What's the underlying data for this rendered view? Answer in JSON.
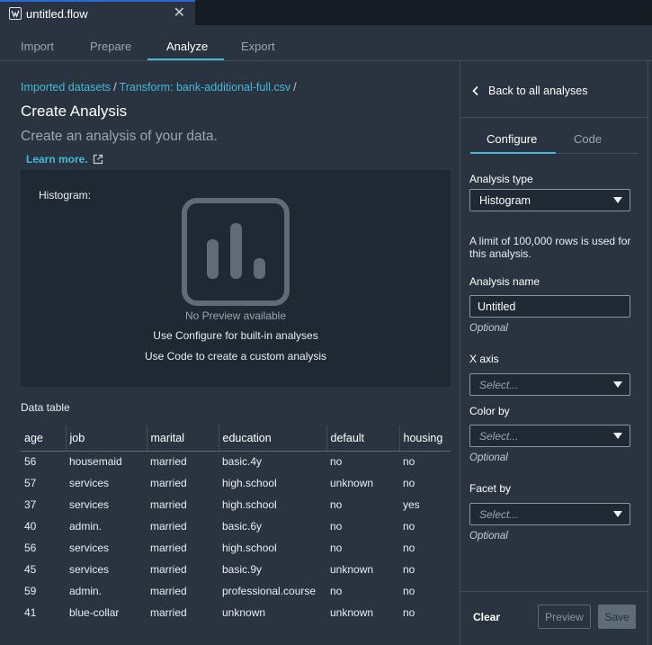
{
  "window": {
    "file_tab": "untitled.flow",
    "close_symbol": "✕"
  },
  "nav": {
    "tabs": [
      "Import",
      "Prepare",
      "Analyze",
      "Export"
    ],
    "active": "Analyze"
  },
  "breadcrumb": {
    "items": [
      "Imported datasets",
      "Transform: bank-additional-full.csv"
    ],
    "separator": "/"
  },
  "header": {
    "title": "Create Analysis",
    "subtitle": "Create an analysis of your data.",
    "learn_more": "Learn more."
  },
  "preview": {
    "label": "Histogram:",
    "no_preview": "No Preview available",
    "hint_configure": "Use Configure for built-in analyses",
    "hint_code": "Use Code to create a custom analysis"
  },
  "data_table": {
    "label": "Data table",
    "columns": [
      "age",
      "job",
      "marital",
      "education",
      "default",
      "housing"
    ],
    "rows": [
      [
        "56",
        "housemaid",
        "married",
        "basic.4y",
        "no",
        "no"
      ],
      [
        "57",
        "services",
        "married",
        "high.school",
        "unknown",
        "no"
      ],
      [
        "37",
        "services",
        "married",
        "high.school",
        "no",
        "yes"
      ],
      [
        "40",
        "admin.",
        "married",
        "basic.6y",
        "no",
        "no"
      ],
      [
        "56",
        "services",
        "married",
        "high.school",
        "no",
        "no"
      ],
      [
        "45",
        "services",
        "married",
        "basic.9y",
        "unknown",
        "no"
      ],
      [
        "59",
        "admin.",
        "married",
        "professional.course",
        "no",
        "no"
      ],
      [
        "41",
        "blue-collar",
        "married",
        "unknown",
        "unknown",
        "no"
      ]
    ]
  },
  "sidebar": {
    "back": "Back to all analyses",
    "tabs": {
      "configure": "Configure",
      "code": "Code"
    },
    "analysis_type": {
      "label": "Analysis type",
      "value": "Histogram"
    },
    "row_limit_note": "A limit of 100,000 rows is used for this analysis.",
    "analysis_name": {
      "label": "Analysis name",
      "value": "Untitled",
      "hint": "Optional"
    },
    "x_axis": {
      "label": "X axis",
      "placeholder": "Select..."
    },
    "color_by": {
      "label": "Color by",
      "placeholder": "Select...",
      "hint": "Optional"
    },
    "facet_by": {
      "label": "Facet by",
      "placeholder": "Select...",
      "hint": "Optional"
    },
    "buttons": {
      "clear": "Clear",
      "preview": "Preview",
      "save": "Save"
    }
  },
  "colors": {
    "accent": "#44b9d6",
    "background": "#2a3441",
    "panel": "#1f2933"
  }
}
